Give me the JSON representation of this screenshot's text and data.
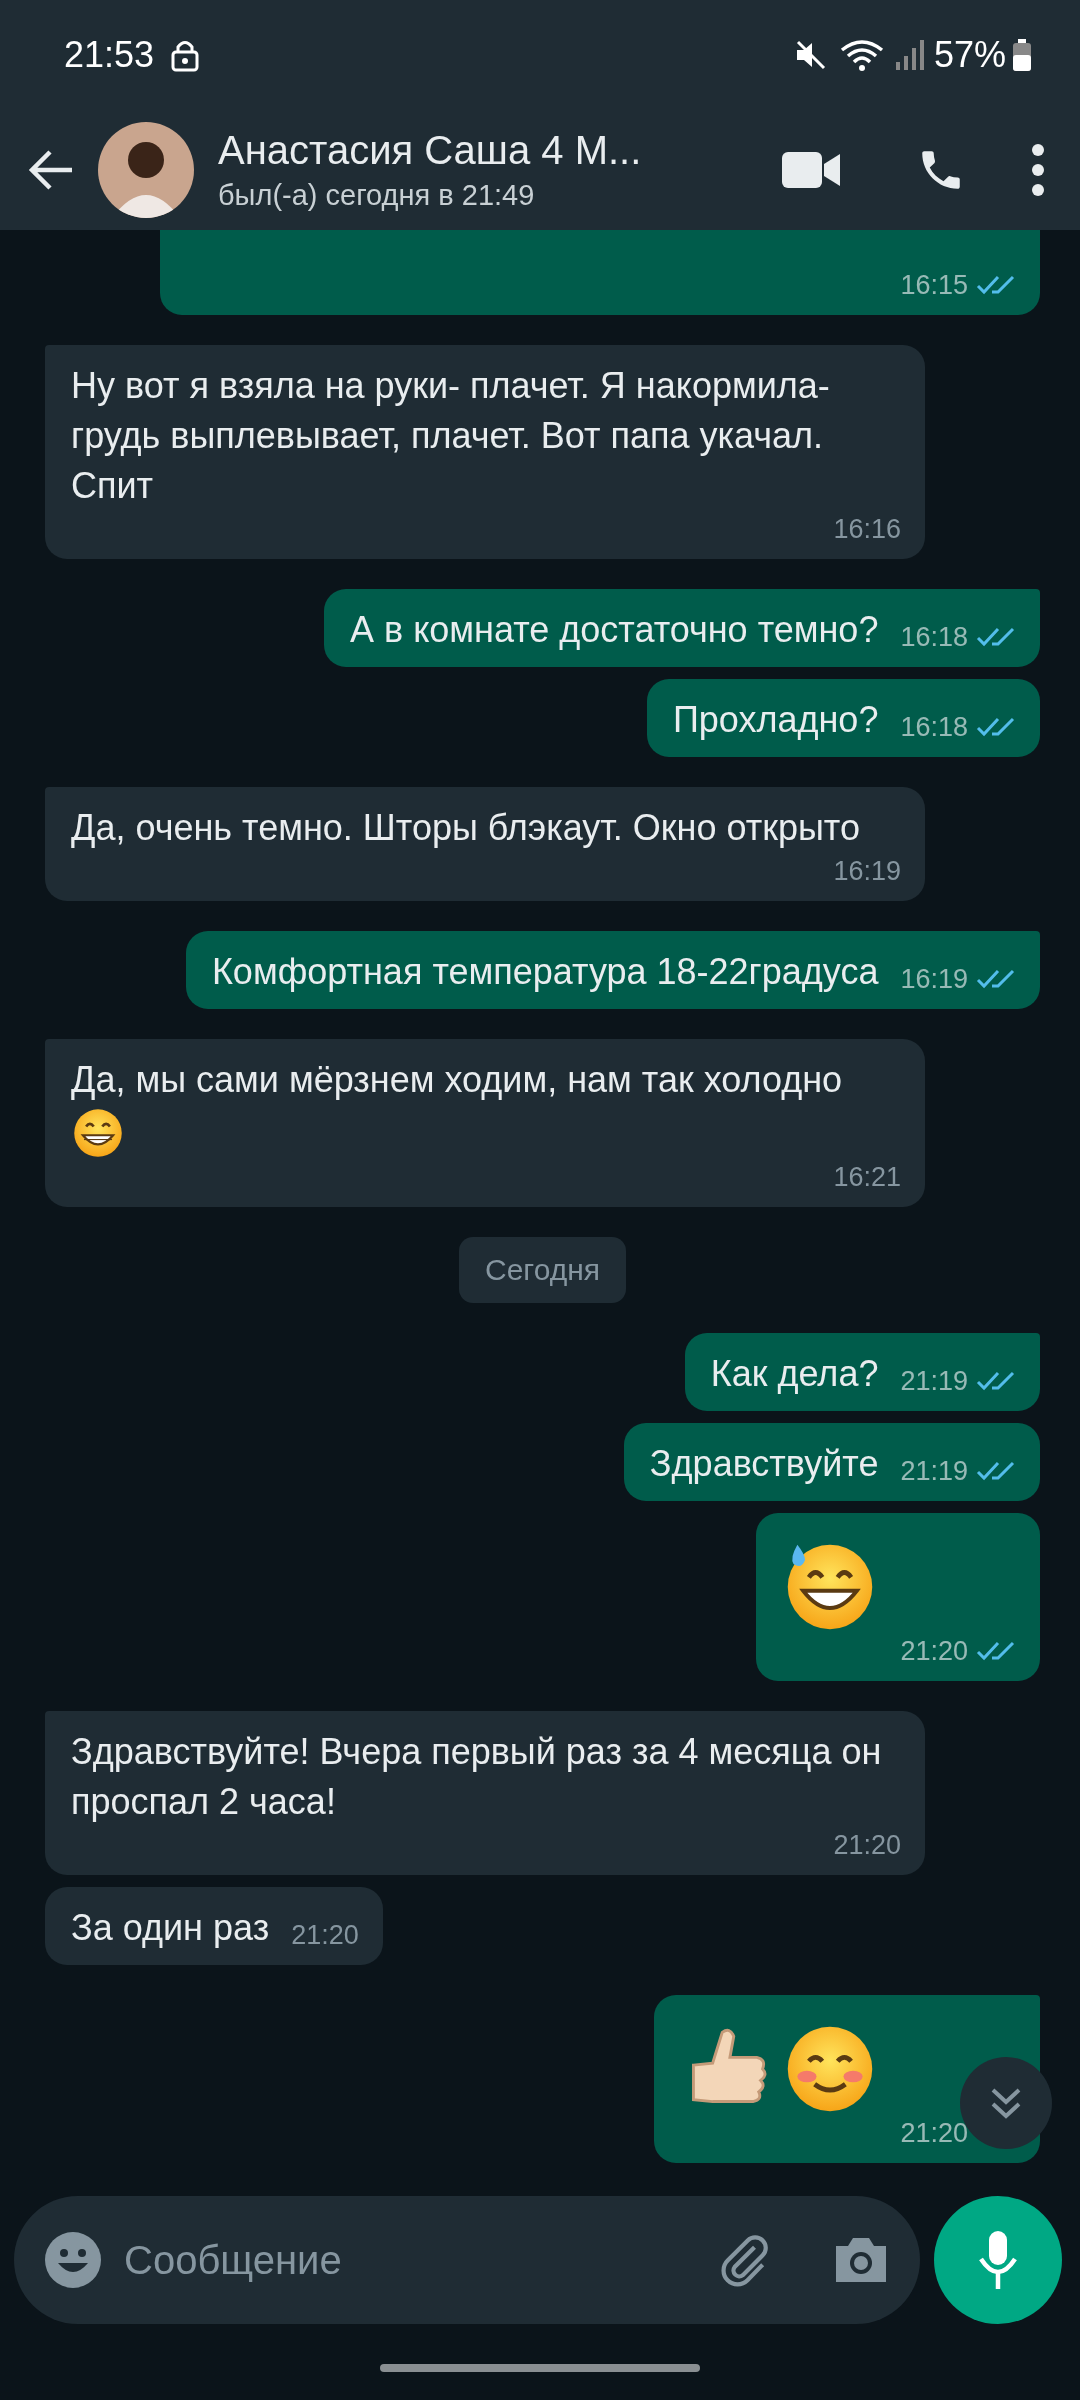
{
  "status_bar": {
    "time": "21:53",
    "battery": "57%"
  },
  "header": {
    "title": "Анастасия Саша 4 М...",
    "subtitle": "был(-а) сегодня в 21:49"
  },
  "messages": [
    {
      "kind": "clipped",
      "outgoing": true,
      "time": "16:15",
      "read": true
    },
    {
      "kind": "text",
      "outgoing": false,
      "tail": true,
      "text": "Ну вот я взяла на руки- плачет. Я накормила-грудь выплевывает, плачет. Вот папа укачал. Спит",
      "time": "16:16"
    },
    {
      "kind": "text",
      "outgoing": true,
      "tail": true,
      "text": "А в комнате достаточно темно?",
      "time": "16:18",
      "read": true
    },
    {
      "kind": "text",
      "outgoing": true,
      "tail": false,
      "text": "Прохладно?",
      "time": "16:18",
      "read": true
    },
    {
      "kind": "text",
      "outgoing": false,
      "tail": true,
      "text": "Да, очень темно. Шторы блэкаут. Окно открыто",
      "time": "16:19"
    },
    {
      "kind": "text",
      "outgoing": true,
      "tail": true,
      "text": "Комфортная температура 18-22градуса",
      "time": "16:19",
      "read": true
    },
    {
      "kind": "text",
      "outgoing": false,
      "tail": true,
      "text": "Да, мы сами мёрзнем ходим, нам так холодно",
      "emoji": {
        "kind": "grin"
      },
      "time": "16:21"
    },
    {
      "kind": "date",
      "text": "Сегодня"
    },
    {
      "kind": "text",
      "outgoing": true,
      "tail": true,
      "text": "Как дела?",
      "time": "21:19",
      "read": true
    },
    {
      "kind": "text",
      "outgoing": true,
      "tail": false,
      "text": "Здравствуйте",
      "time": "21:19",
      "read": true
    },
    {
      "kind": "emoji",
      "outgoing": true,
      "tail": false,
      "emojis": [
        {
          "kind": "sweat-smile"
        }
      ],
      "time": "21:20",
      "read": true
    },
    {
      "kind": "text",
      "outgoing": false,
      "tail": true,
      "text": "Здравствуйте! Вчера первый раз за 4 месяца он проспал 2 часа!",
      "time": "21:20"
    },
    {
      "kind": "text",
      "outgoing": false,
      "tail": false,
      "text": "За один раз",
      "time": "21:20"
    },
    {
      "kind": "emoji",
      "outgoing": true,
      "tail": true,
      "emojis": [
        {
          "kind": "thumbs-up"
        },
        {
          "kind": "blush"
        }
      ],
      "time": "21:20"
    }
  ],
  "composer": {
    "placeholder": "Сообщение"
  }
}
